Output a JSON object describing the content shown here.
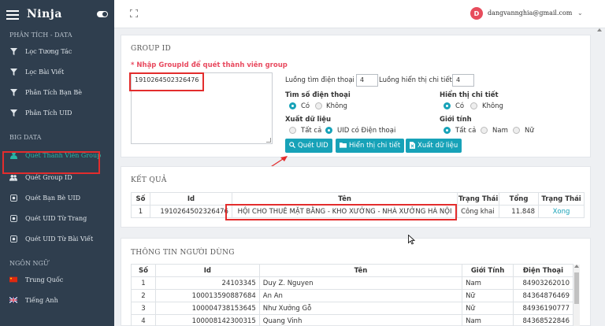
{
  "app": {
    "title": "Ninja"
  },
  "sidebar": {
    "sections": [
      {
        "title": "PHÂN TÍCH - DATA",
        "items": [
          {
            "label": "Lọc Tương Tác",
            "icon": "filter-icon"
          },
          {
            "label": "Lọc Bài Viết",
            "icon": "filter-icon"
          },
          {
            "label": "Phân Tích Bạn Bè",
            "icon": "filter-icon"
          },
          {
            "label": "Phân Tích UID",
            "icon": "filter-icon"
          }
        ]
      },
      {
        "title": "BIG DATA",
        "items": [
          {
            "label": "Quét Thành Viên Group",
            "icon": "user-icon",
            "active": true
          },
          {
            "label": "Quét Group ID",
            "icon": "users-icon"
          },
          {
            "label": "Quét Bạn Bè UID",
            "icon": "box-icon"
          },
          {
            "label": "Quét UID Từ Trang",
            "icon": "box-icon"
          },
          {
            "label": "Quét UID Từ Bài Viết",
            "icon": "box-icon"
          }
        ]
      },
      {
        "title": "NGÔN NGỮ",
        "items": [
          {
            "label": "Trung Quốc",
            "icon": "china-flag-icon"
          },
          {
            "label": "Tiếng Anh",
            "icon": "uk-flag-icon"
          }
        ]
      }
    ]
  },
  "topbar": {
    "avatar_letter": "D",
    "email": "dangvannghia@gmail.com"
  },
  "group_panel": {
    "title": "GROUP ID",
    "required_label": "* Nhập GroupId để quét thành viên group",
    "group_id_value": "1910264502326476",
    "phone_threads_label": "Luồng tìm điện thoại",
    "phone_threads_value": "4",
    "detail_threads_label": "Luồng hiển thị chi tiết",
    "detail_threads_value": "4",
    "find_phone": {
      "label": "Tìm số điện thoại",
      "opt_yes": "Có",
      "opt_no": "Không"
    },
    "show_detail": {
      "label": "Hiển thị chi tiết",
      "opt_yes": "Có",
      "opt_no": "Không"
    },
    "export_data": {
      "label": "Xuất dữ liệu",
      "opt_all": "Tất cả",
      "opt_phone": "UID có Điện thoại"
    },
    "gender": {
      "label": "Giới tính",
      "opt_all": "Tất cả",
      "opt_male": "Nam",
      "opt_female": "Nữ"
    },
    "buttons": {
      "scan": "Quét UID",
      "show_detail": "Hiển thị chi tiết",
      "export": "Xuất dữ liệu"
    }
  },
  "result_panel": {
    "title": "KẾT QUẢ",
    "headers": [
      "Số",
      "Id",
      "Tên",
      "Trạng Thái",
      "Tổng",
      "Trạng Thái"
    ],
    "rows": [
      [
        "1",
        "1910264502326476",
        "HỘI CHO THUÊ MẶT BẰNG - KHO XƯỞNG - NHÀ XƯỞNG HÀ NỘI",
        "Công khai",
        "11.848",
        "Xong"
      ]
    ]
  },
  "user_panel": {
    "title": "THÔNG TIN NGƯỜI DÙNG",
    "headers": [
      "Số",
      "Id",
      "Tên",
      "Giới Tính",
      "Điện Thoại"
    ],
    "rows": [
      [
        "1",
        "24103345",
        "Duy Z. Nguyen",
        "Nam",
        "84903262010"
      ],
      [
        "2",
        "100013590887684",
        "An An",
        "Nữ",
        "84364876469"
      ],
      [
        "3",
        "100004738153645",
        "Như Xưởng Gỗ",
        "Nữ",
        "84936190777"
      ],
      [
        "4",
        "100008142300315",
        "Quang Vinh",
        "Nam",
        "84368522846"
      ]
    ]
  },
  "colors": {
    "sidebar_bg": "#2f3e4e",
    "accent": "#17a2b8",
    "required": "#e84a5f",
    "highlight": "#e32d2d"
  }
}
